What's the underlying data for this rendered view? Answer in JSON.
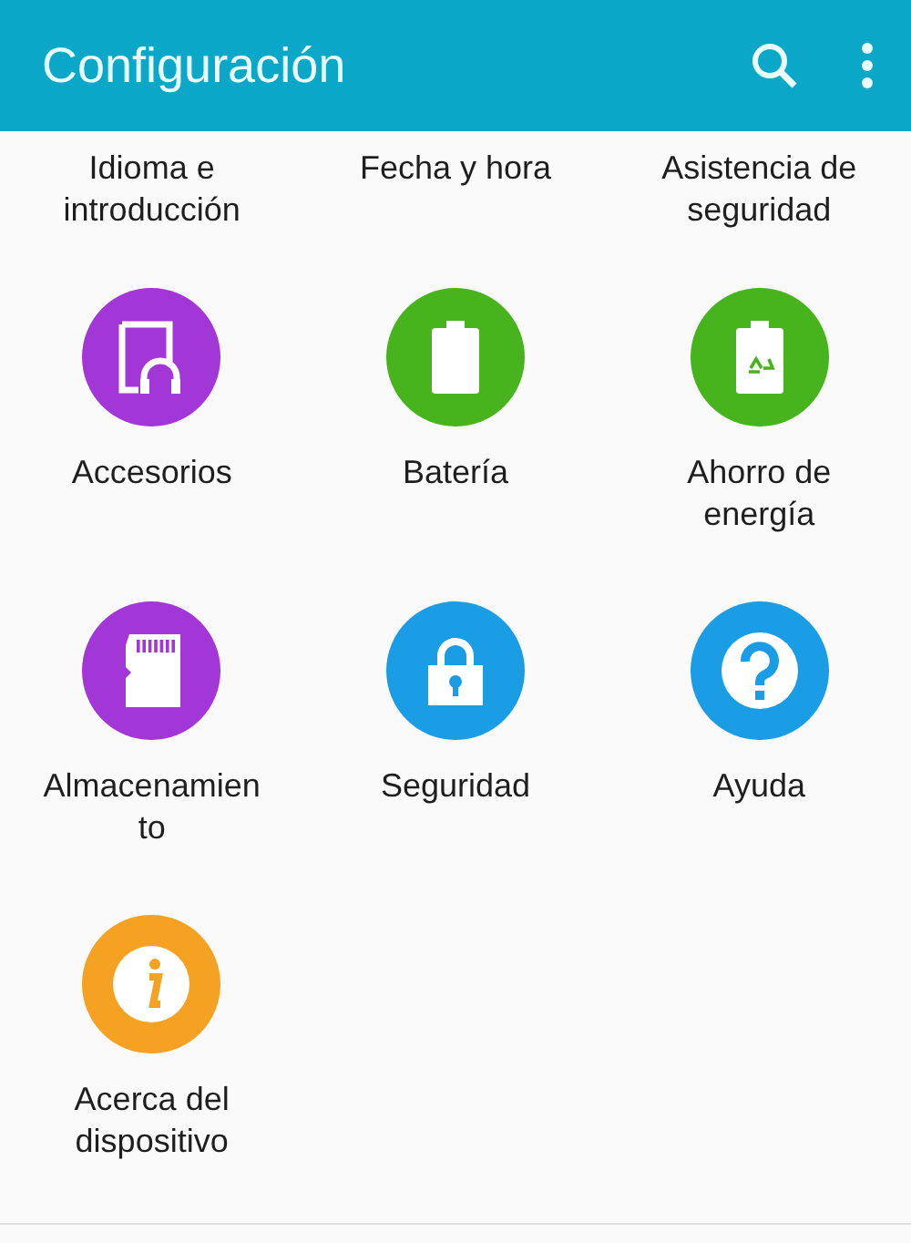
{
  "app_bar": {
    "title": "Configuración"
  },
  "top_row": [
    "Idioma e introducción",
    "Fecha y hora",
    "Asistencia de seguridad"
  ],
  "items": [
    {
      "label": "Accesorios",
      "color": "#a236d6"
    },
    {
      "label": "Batería",
      "color": "#47b41e"
    },
    {
      "label": "Ahorro de energía",
      "color": "#47b41e"
    },
    {
      "label": "Almacenamien\nto",
      "color": "#a236d6"
    },
    {
      "label": "Seguridad",
      "color": "#1b9de5"
    },
    {
      "label": "Ayuda",
      "color": "#1b9de5"
    },
    {
      "label": "Acerca del dispositivo",
      "color": "#f5a223"
    }
  ]
}
